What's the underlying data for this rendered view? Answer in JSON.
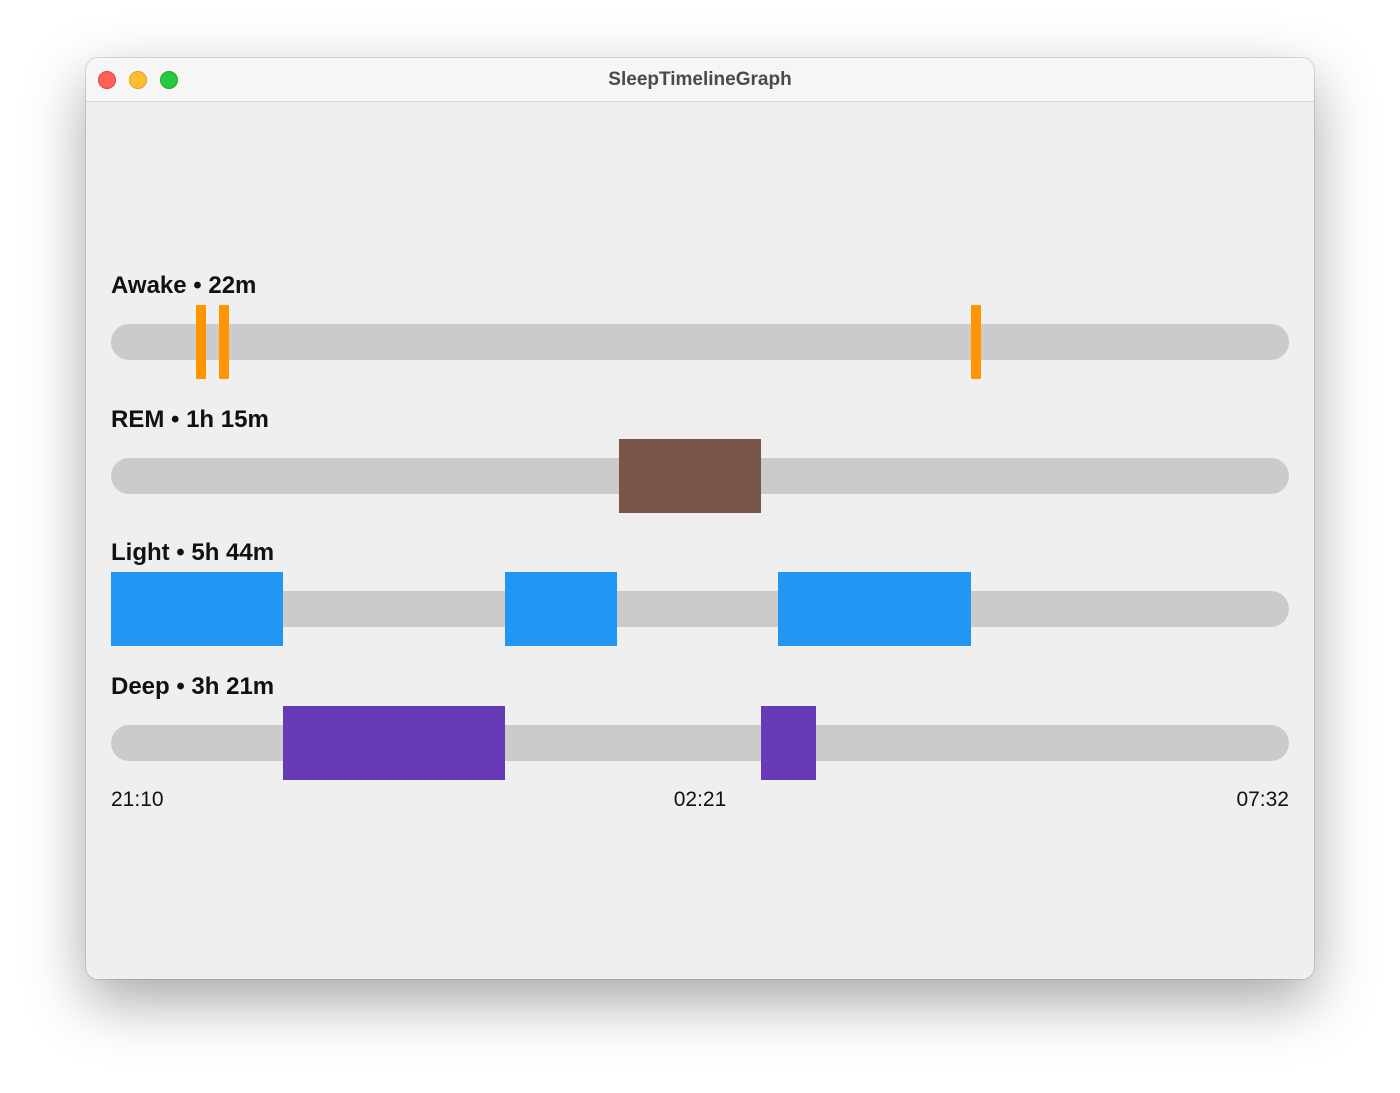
{
  "window": {
    "title": "SleepTimelineGraph"
  },
  "timeline": {
    "start": "21:10",
    "mid": "02:21",
    "end": "07:32"
  },
  "stages": [
    {
      "key": "awake",
      "name": "Awake",
      "duration": "22m",
      "label": "Awake • 22m",
      "color": "#ff9500",
      "segments": [
        {
          "start": "21:55",
          "end": "21:57"
        },
        {
          "start": "22:07",
          "end": "22:11"
        },
        {
          "start": "04:44",
          "end": "04:46"
        }
      ]
    },
    {
      "key": "rem",
      "name": "REM",
      "duration": "1h 15m",
      "label": "REM • 1h 15m",
      "color": "#7a5649",
      "segments": [
        {
          "start": "01:38",
          "end": "02:53"
        }
      ]
    },
    {
      "key": "light",
      "name": "Light",
      "duration": "5h 44m",
      "label": "Light • 5h 44m",
      "color": "#2196f3",
      "segments": [
        {
          "start": "21:10",
          "end": "22:41"
        },
        {
          "start": "00:38",
          "end": "01:37"
        },
        {
          "start": "03:02",
          "end": "04:44"
        }
      ]
    },
    {
      "key": "deep",
      "name": "Deep",
      "duration": "3h 21m",
      "label": "Deep • 3h 21m",
      "color": "#673ab7",
      "segments": [
        {
          "start": "22:41",
          "end": "00:38"
        },
        {
          "start": "02:53",
          "end": "03:22"
        }
      ]
    }
  ]
}
